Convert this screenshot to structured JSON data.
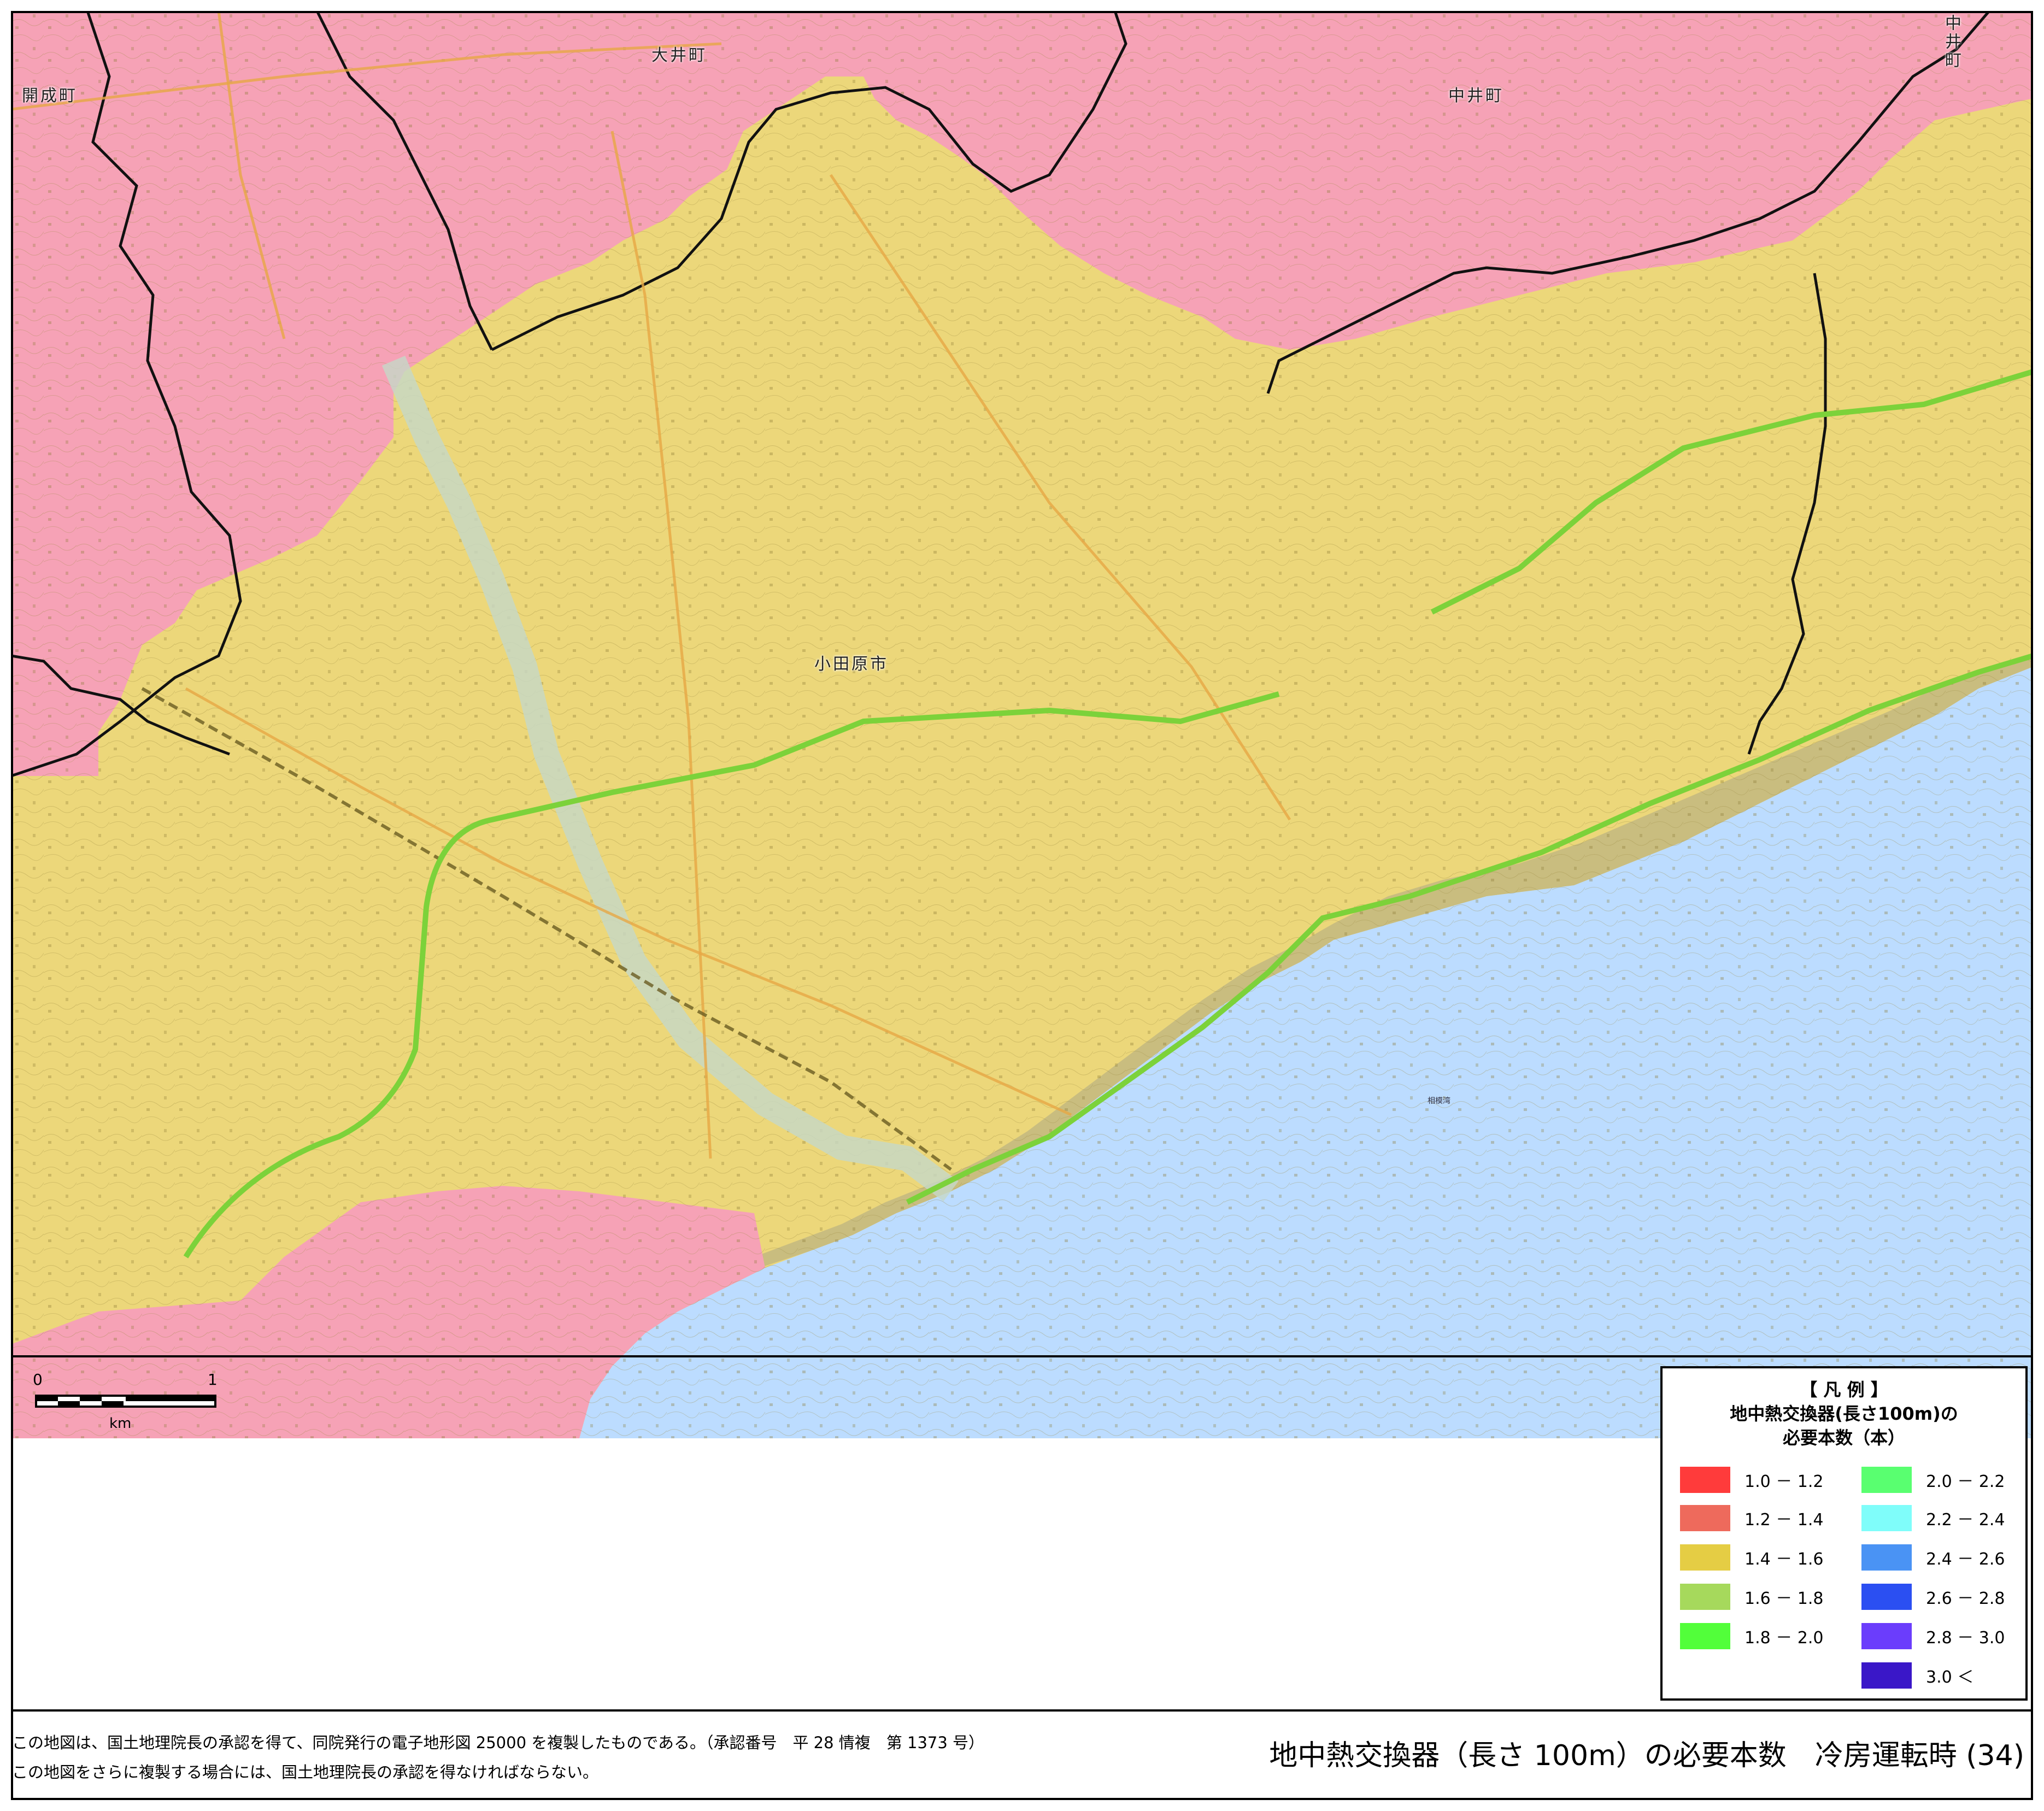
{
  "map": {
    "places": [
      {
        "id": "kaisei",
        "label": "開成町"
      },
      {
        "id": "oi",
        "label": "大井町"
      },
      {
        "id": "nakai",
        "label": "中井町"
      },
      {
        "id": "nakai-edge",
        "label": "中井町"
      },
      {
        "id": "odawara",
        "label": "小田原市"
      }
    ],
    "sea_name": "相模湾",
    "colors": {
      "pink": "#f6a2b6",
      "yellow": "#ecd77a",
      "olive": "#c9bd7f",
      "sea": "#bcdcff",
      "boundary": "#111111",
      "highway": "#7cd23a",
      "road": "#e7a845"
    }
  },
  "scale": {
    "start": "0",
    "end": "1",
    "unit": "km"
  },
  "legend": {
    "title_line1": "【 凡 例 】",
    "title_line2": "地中熱交換器(長さ100m)の",
    "title_line3": "必要本数（本）",
    "items_left": [
      {
        "label": "1.0 － 1.2",
        "color": "#ff3b3b"
      },
      {
        "label": "1.2 － 1.4",
        "color": "#ee6a5c"
      },
      {
        "label": "1.4 － 1.6",
        "color": "#e5cd44"
      },
      {
        "label": "1.6 － 1.8",
        "color": "#a6d95c"
      },
      {
        "label": "1.8 － 2.0",
        "color": "#52ff3a"
      }
    ],
    "items_right": [
      {
        "label": "2.0 － 2.2",
        "color": "#59ff70"
      },
      {
        "label": "2.2 － 2.4",
        "color": "#7ffdfa"
      },
      {
        "label": "2.4 － 2.6",
        "color": "#4a93f4"
      },
      {
        "label": "2.6 － 2.8",
        "color": "#2b4ff2"
      },
      {
        "label": "2.8 － 3.0",
        "color": "#6b3dfc"
      },
      {
        "label": "3.0 ＜",
        "color": "#3a17c8"
      }
    ]
  },
  "footer": {
    "note1": "この地図は、国土地理院長の承認を得て、同院発行の電子地形図 25000 を複製したものである。（承認番号　平 28 情複　第 1373 号）",
    "note2": "この地図をさらに複製する場合には、国土地理院長の承認を得なければならない。",
    "title": "地中熱交換器（長さ 100m）の必要本数　冷房運転時 (34)"
  }
}
